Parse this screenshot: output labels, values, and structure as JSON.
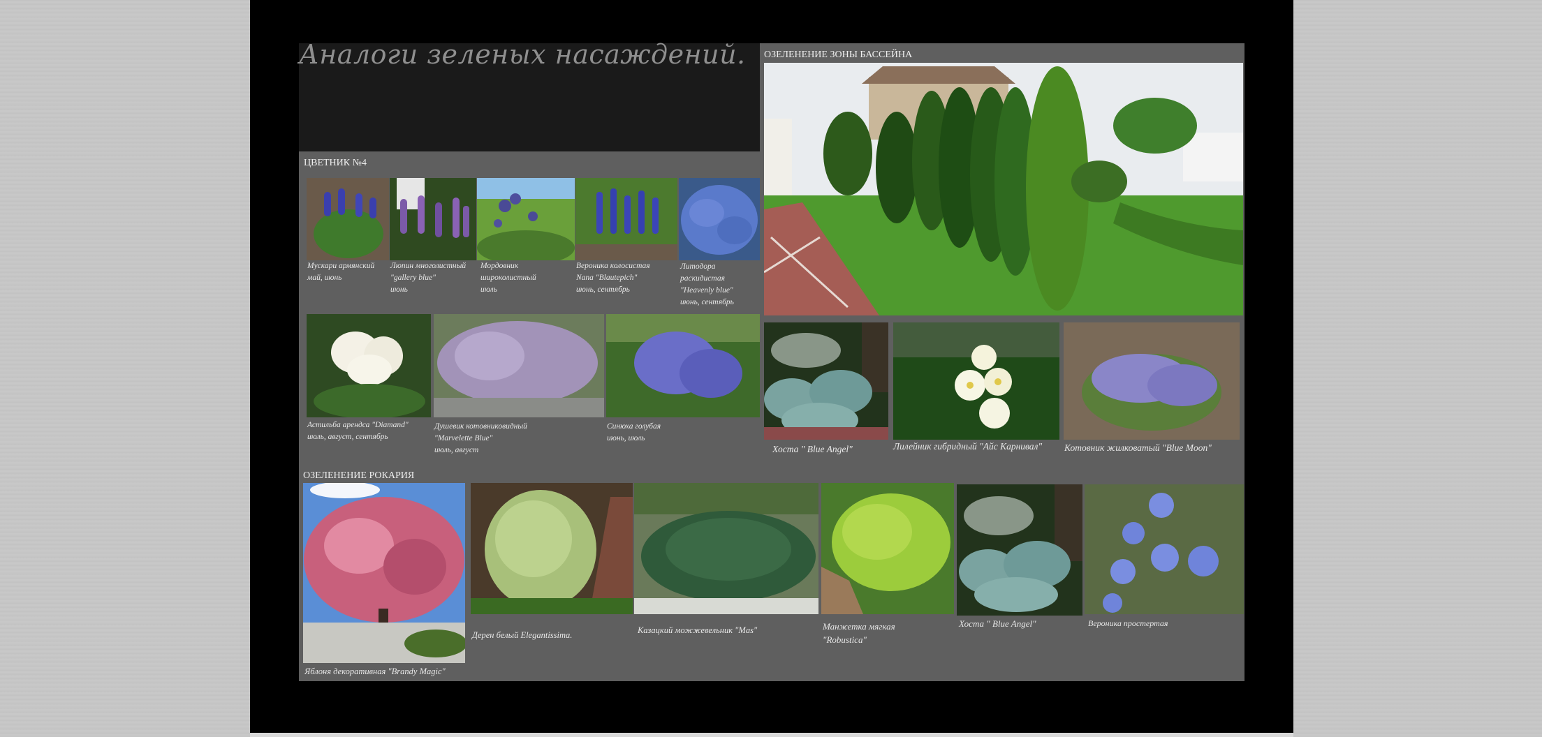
{
  "slide": {
    "title": "Аналоги зеленых насаждений."
  },
  "pool": {
    "heading": "ОЗЕЛЕНЕНИЕ ЗОНЫ БАССЕЙНА",
    "captions": [
      "Хоста \" Blue Angel\"",
      "Лилейник гибридный \"Айс Карнивал\"",
      "Котовник жилковатый \"Blue Moon\""
    ]
  },
  "flowerbed": {
    "heading": "ЦВЕТНИК №4",
    "row1": [
      [
        "Мускари армянский",
        "май, июнь"
      ],
      [
        "Люпин многолистный",
        "\"gallery blue\"",
        "июнь"
      ],
      [
        "Мордовник",
        "широколистный",
        "июль"
      ],
      [
        "Вероника колосистая",
        "Nana \"Blautepich\"",
        "июнь, сентябрь"
      ],
      [
        "Литодора",
        "раскидистая",
        "\"Heavenly blue\"",
        "июнь, сентябрь"
      ]
    ],
    "row2": [
      [
        "Астильба арендса \"Diamand\"",
        "июль, август, сентябрь"
      ],
      [
        "Душевик котовниковидный",
        "\"Marvelette Blue\"",
        "июль, август"
      ],
      [
        "Синюха голубая",
        "июнь, июль"
      ]
    ]
  },
  "rockery": {
    "heading": "ОЗЕЛЕНЕНИЕ РОКАРИЯ",
    "captions": [
      [
        "Яблоня декоративная \"Brandy Magic\""
      ],
      [
        "Дерен белый Elegantissima."
      ],
      [
        "Казацкий можжевельник \"Mas\""
      ],
      [
        "Манжетка мягкая",
        "\"Robustica\""
      ],
      [
        "Хоста \" Blue Angel\""
      ],
      [
        "Вероника простертая"
      ]
    ]
  },
  "colors": {
    "slide_bg": "#000000",
    "panel_bg": "#5f5f5f",
    "title_bg": "#1a1a1a",
    "title_text": "#8f8f8f",
    "caption_text": "#e8e8e8"
  }
}
